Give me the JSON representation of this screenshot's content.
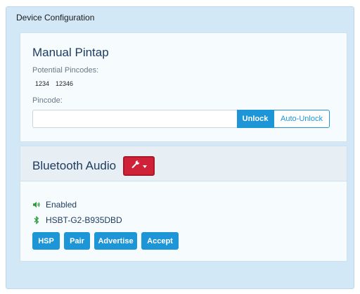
{
  "outer": {
    "title": "Device Configuration"
  },
  "manual_pintap": {
    "title": "Manual Pintap",
    "potential_label": "Potential Pincodes:",
    "pincodes": [
      "1234",
      "12346"
    ],
    "pincode_label": "Pincode:",
    "pincode_value": "",
    "pincode_placeholder": "",
    "unlock_label": "Unlock",
    "auto_unlock_label": "Auto-Unlock"
  },
  "bluetooth": {
    "title": "Bluetooth Audio",
    "tool_icon": "wrench-icon",
    "status_icon": "speaker-icon",
    "status_text": "Enabled",
    "device_icon": "bluetooth-icon",
    "device_name": "HSBT-G2-B935DBD",
    "actions": [
      "HSP",
      "Pair",
      "Advertise",
      "Accept"
    ]
  },
  "colors": {
    "panel_bg": "#d3e8f7",
    "accent_blue": "#1e95d6",
    "danger_red": "#cf2137",
    "title_navy": "#1c3a5e",
    "success_green": "#2e9c3e"
  }
}
